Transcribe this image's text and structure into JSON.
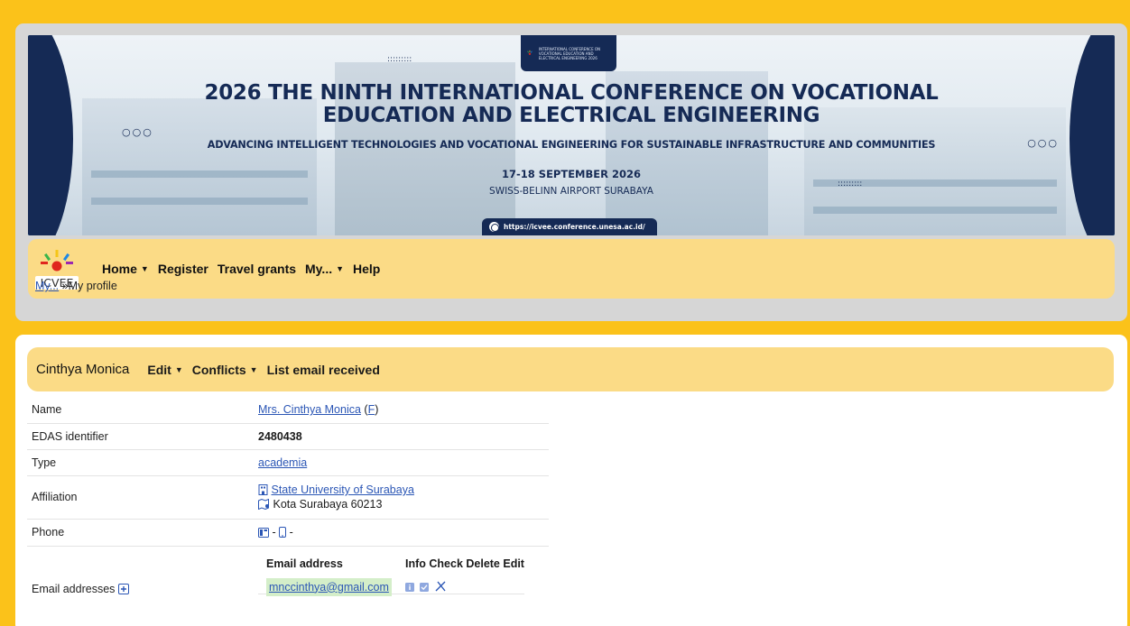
{
  "banner": {
    "title_line1": "2026 THE NINTH INTERNATIONAL CONFERENCE ON VOCATIONAL",
    "title_line2": "EDUCATION AND ELECTRICAL ENGINEERING",
    "subtitle": "ADVANCING INTELLIGENT TECHNOLOGIES AND VOCATIONAL ENGINEERING FOR SUSTAINABLE INFRASTRUCTURE AND COMMUNITIES",
    "dates": "17-18 SEPTEMBER 2026",
    "venue": "SWISS-BELINN AIRPORT SURABAYA",
    "url": "https://icvee.conference.unesa.ac.id/",
    "badge_text": "INTERNATIONAL CONFERENCE ON VOCATIONAL EDUCATION AND ELECTRICAL ENGINEERING 2026",
    "badge_logo": "ICVEE",
    "dots_left": "○○○",
    "dots_right": "○○○",
    "grid_dots_top": ":::::::::",
    "grid_dots_bottom": ":::::::::"
  },
  "nav": {
    "logo_text": "ICVEE",
    "items": [
      {
        "label": "Home",
        "dropdown": true
      },
      {
        "label": "Register",
        "dropdown": false
      },
      {
        "label": "Travel grants",
        "dropdown": false
      },
      {
        "label": "My...",
        "dropdown": true
      },
      {
        "label": "Help",
        "dropdown": false
      }
    ]
  },
  "breadcrumb": {
    "link": "My...",
    "separator": "»",
    "current": "My profile"
  },
  "profile_bar": {
    "name": "Cinthya Monica",
    "edit": "Edit",
    "conflicts": "Conflicts",
    "list_email": "List email received"
  },
  "profile": {
    "name_label": "Name",
    "name_value": "Mrs. Cinthya Monica",
    "name_suffix_open": " (",
    "name_suffix_link": "F",
    "name_suffix_close": ")",
    "edas_label": "EDAS identifier",
    "edas_value": "2480438",
    "type_label": "Type",
    "type_value": "academia",
    "affiliation_label": "Affiliation",
    "affiliation_value": "State University of Surabaya",
    "affiliation_location": "Kota Surabaya 60213",
    "phone_label": "Phone",
    "phone_sep1": " - ",
    "phone_sep2": " -",
    "emails_label": "Email addresses",
    "email_headers": {
      "address": "Email address",
      "actions": "Info Check Delete Edit"
    },
    "emails": [
      "mnccinthya@gmail.com"
    ]
  },
  "colors": {
    "page_bg": "#fbc21a",
    "nav_bg": "#fbdb86",
    "banner_navy": "#152a55",
    "banner_cyan": "#1fa6e0",
    "link": "#2b56b5",
    "email_highlight": "#d4eec9"
  }
}
